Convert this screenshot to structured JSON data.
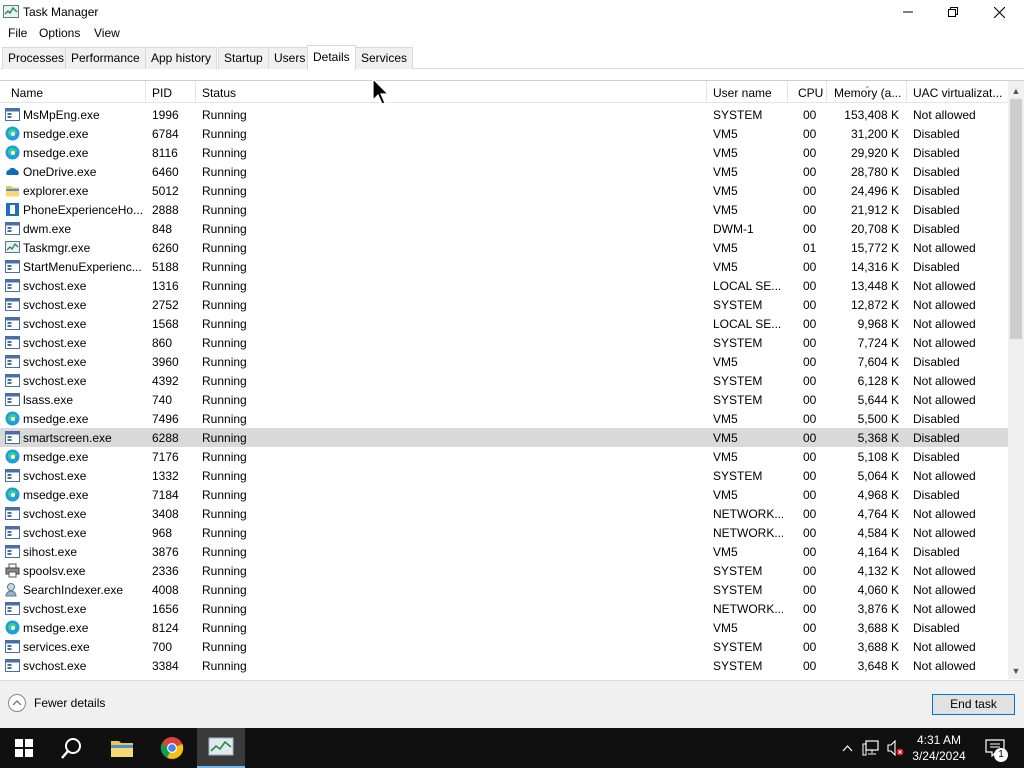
{
  "window": {
    "title": "Task Manager"
  },
  "menu": [
    "File",
    "Options",
    "View"
  ],
  "tabs": [
    "Processes",
    "Performance",
    "App history",
    "Startup",
    "Users",
    "Details",
    "Services"
  ],
  "active_tab": "Details",
  "columns": {
    "name": "Name",
    "pid": "PID",
    "status": "Status",
    "user": "User name",
    "cpu": "CPU",
    "memory": "Memory (a...",
    "uac": "UAC virtualizat..."
  },
  "rows": [
    {
      "icon": "defender",
      "name": "MsMpEng.exe",
      "pid": "1996",
      "status": "Running",
      "user": "SYSTEM",
      "cpu": "00",
      "mem": "153,408 K",
      "uac": "Not allowed"
    },
    {
      "icon": "edge",
      "name": "msedge.exe",
      "pid": "6784",
      "status": "Running",
      "user": "VM5",
      "cpu": "00",
      "mem": "31,200 K",
      "uac": "Disabled"
    },
    {
      "icon": "edge",
      "name": "msedge.exe",
      "pid": "8116",
      "status": "Running",
      "user": "VM5",
      "cpu": "00",
      "mem": "29,920 K",
      "uac": "Disabled"
    },
    {
      "icon": "onedrive",
      "name": "OneDrive.exe",
      "pid": "6460",
      "status": "Running",
      "user": "VM5",
      "cpu": "00",
      "mem": "28,780 K",
      "uac": "Disabled"
    },
    {
      "icon": "explorer",
      "name": "explorer.exe",
      "pid": "5012",
      "status": "Running",
      "user": "VM5",
      "cpu": "00",
      "mem": "24,496 K",
      "uac": "Disabled"
    },
    {
      "icon": "phone",
      "name": "PhoneExperienceHo...",
      "pid": "2888",
      "status": "Running",
      "user": "VM5",
      "cpu": "00",
      "mem": "21,912 K",
      "uac": "Disabled"
    },
    {
      "icon": "generic",
      "name": "dwm.exe",
      "pid": "848",
      "status": "Running",
      "user": "DWM-1",
      "cpu": "00",
      "mem": "20,708 K",
      "uac": "Disabled"
    },
    {
      "icon": "taskmgr",
      "name": "Taskmgr.exe",
      "pid": "6260",
      "status": "Running",
      "user": "VM5",
      "cpu": "01",
      "mem": "15,772 K",
      "uac": "Not allowed"
    },
    {
      "icon": "generic",
      "name": "StartMenuExperienc...",
      "pid": "5188",
      "status": "Running",
      "user": "VM5",
      "cpu": "00",
      "mem": "14,316 K",
      "uac": "Disabled"
    },
    {
      "icon": "generic",
      "name": "svchost.exe",
      "pid": "1316",
      "status": "Running",
      "user": "LOCAL SE...",
      "cpu": "00",
      "mem": "13,448 K",
      "uac": "Not allowed"
    },
    {
      "icon": "generic",
      "name": "svchost.exe",
      "pid": "2752",
      "status": "Running",
      "user": "SYSTEM",
      "cpu": "00",
      "mem": "12,872 K",
      "uac": "Not allowed"
    },
    {
      "icon": "generic",
      "name": "svchost.exe",
      "pid": "1568",
      "status": "Running",
      "user": "LOCAL SE...",
      "cpu": "00",
      "mem": "9,968 K",
      "uac": "Not allowed"
    },
    {
      "icon": "generic",
      "name": "svchost.exe",
      "pid": "860",
      "status": "Running",
      "user": "SYSTEM",
      "cpu": "00",
      "mem": "7,724 K",
      "uac": "Not allowed"
    },
    {
      "icon": "generic",
      "name": "svchost.exe",
      "pid": "3960",
      "status": "Running",
      "user": "VM5",
      "cpu": "00",
      "mem": "7,604 K",
      "uac": "Disabled"
    },
    {
      "icon": "generic",
      "name": "svchost.exe",
      "pid": "4392",
      "status": "Running",
      "user": "SYSTEM",
      "cpu": "00",
      "mem": "6,128 K",
      "uac": "Not allowed"
    },
    {
      "icon": "generic",
      "name": "lsass.exe",
      "pid": "740",
      "status": "Running",
      "user": "SYSTEM",
      "cpu": "00",
      "mem": "5,644 K",
      "uac": "Not allowed"
    },
    {
      "icon": "edge",
      "name": "msedge.exe",
      "pid": "7496",
      "status": "Running",
      "user": "VM5",
      "cpu": "00",
      "mem": "5,500 K",
      "uac": "Disabled"
    },
    {
      "icon": "generic",
      "name": "smartscreen.exe",
      "pid": "6288",
      "status": "Running",
      "user": "VM5",
      "cpu": "00",
      "mem": "5,368 K",
      "uac": "Disabled",
      "selected": true
    },
    {
      "icon": "edge",
      "name": "msedge.exe",
      "pid": "7176",
      "status": "Running",
      "user": "VM5",
      "cpu": "00",
      "mem": "5,108 K",
      "uac": "Disabled"
    },
    {
      "icon": "generic",
      "name": "svchost.exe",
      "pid": "1332",
      "status": "Running",
      "user": "SYSTEM",
      "cpu": "00",
      "mem": "5,064 K",
      "uac": "Not allowed"
    },
    {
      "icon": "edge",
      "name": "msedge.exe",
      "pid": "7184",
      "status": "Running",
      "user": "VM5",
      "cpu": "00",
      "mem": "4,968 K",
      "uac": "Disabled"
    },
    {
      "icon": "generic",
      "name": "svchost.exe",
      "pid": "3408",
      "status": "Running",
      "user": "NETWORK...",
      "cpu": "00",
      "mem": "4,764 K",
      "uac": "Not allowed"
    },
    {
      "icon": "generic",
      "name": "svchost.exe",
      "pid": "968",
      "status": "Running",
      "user": "NETWORK...",
      "cpu": "00",
      "mem": "4,584 K",
      "uac": "Not allowed"
    },
    {
      "icon": "generic",
      "name": "sihost.exe",
      "pid": "3876",
      "status": "Running",
      "user": "VM5",
      "cpu": "00",
      "mem": "4,164 K",
      "uac": "Disabled"
    },
    {
      "icon": "printer",
      "name": "spoolsv.exe",
      "pid": "2336",
      "status": "Running",
      "user": "SYSTEM",
      "cpu": "00",
      "mem": "4,132 K",
      "uac": "Not allowed"
    },
    {
      "icon": "search",
      "name": "SearchIndexer.exe",
      "pid": "4008",
      "status": "Running",
      "user": "SYSTEM",
      "cpu": "00",
      "mem": "4,060 K",
      "uac": "Not allowed"
    },
    {
      "icon": "generic",
      "name": "svchost.exe",
      "pid": "1656",
      "status": "Running",
      "user": "NETWORK...",
      "cpu": "00",
      "mem": "3,876 K",
      "uac": "Not allowed"
    },
    {
      "icon": "edge",
      "name": "msedge.exe",
      "pid": "8124",
      "status": "Running",
      "user": "VM5",
      "cpu": "00",
      "mem": "3,688 K",
      "uac": "Disabled"
    },
    {
      "icon": "generic",
      "name": "services.exe",
      "pid": "700",
      "status": "Running",
      "user": "SYSTEM",
      "cpu": "00",
      "mem": "3,688 K",
      "uac": "Not allowed"
    },
    {
      "icon": "generic",
      "name": "svchost.exe",
      "pid": "3384",
      "status": "Running",
      "user": "SYSTEM",
      "cpu": "00",
      "mem": "3,648 K",
      "uac": "Not allowed"
    }
  ],
  "footer": {
    "fewer_details": "Fewer details",
    "end_task": "End task"
  },
  "clock": {
    "time": "4:31 AM",
    "date": "3/24/2024"
  },
  "notification_count": "1",
  "colors": {
    "accent": "#0078d7",
    "selected_row": "#d9d9d9",
    "taskbar": "#101010"
  }
}
